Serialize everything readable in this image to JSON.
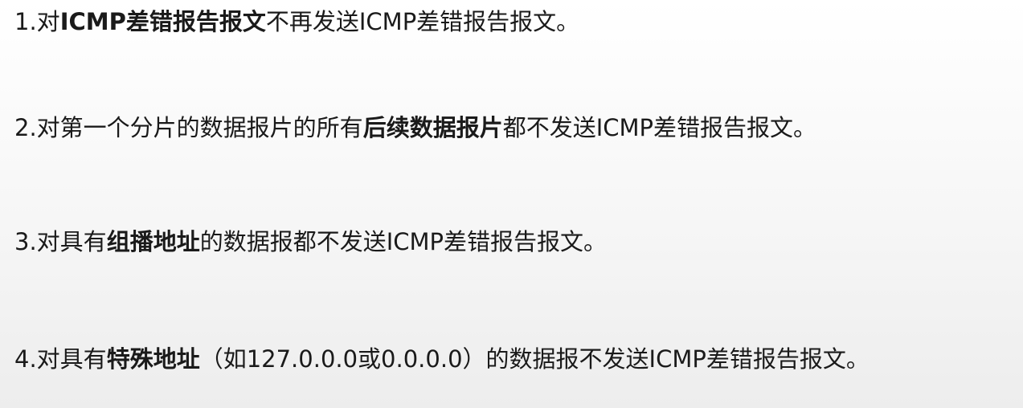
{
  "rules": [
    {
      "number": "1.",
      "segments": [
        {
          "text": "对",
          "bold": false
        },
        {
          "text": "ICMP差错报告报文",
          "bold": true
        },
        {
          "text": "不再发送ICMP差错报告报文。",
          "bold": false
        }
      ]
    },
    {
      "number": "2.",
      "segments": [
        {
          "text": "对第一个分片的数据报片的所有",
          "bold": false
        },
        {
          "text": "后续数据报片",
          "bold": true
        },
        {
          "text": "都不发送ICMP差错报告报文。",
          "bold": false
        }
      ]
    },
    {
      "number": "3.",
      "segments": [
        {
          "text": "对具有",
          "bold": false
        },
        {
          "text": "组播地址",
          "bold": true
        },
        {
          "text": "的数据报都不发送ICMP差错报告报文。",
          "bold": false
        }
      ]
    },
    {
      "number": "4.",
      "segments": [
        {
          "text": "对具有",
          "bold": false
        },
        {
          "text": "特殊地址",
          "bold": true
        },
        {
          "text": "（如127.0.0.0或0.0.0.0）的数据报不发送ICMP差错报告报文。",
          "bold": false
        }
      ]
    }
  ]
}
